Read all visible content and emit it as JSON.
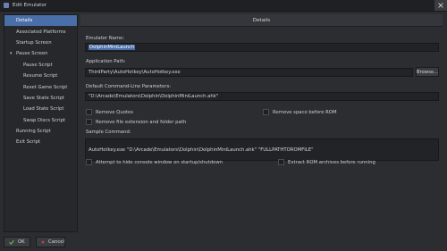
{
  "window": {
    "title": "Edit Emulator"
  },
  "sidebar": {
    "items": [
      {
        "label": "Details",
        "active": true,
        "sub": false
      },
      {
        "label": "Associated Platforms",
        "active": false,
        "sub": false
      },
      {
        "label": "Startup Screen",
        "active": false,
        "sub": false
      },
      {
        "label": "Pause Screen",
        "active": false,
        "sub": false,
        "expanded": true
      },
      {
        "label": "Pause Script",
        "active": false,
        "sub": true
      },
      {
        "label": "Resume Script",
        "active": false,
        "sub": true
      },
      {
        "label": "Reset Game Script",
        "active": false,
        "sub": true
      },
      {
        "label": "Save State Script",
        "active": false,
        "sub": true
      },
      {
        "label": "Load State Script",
        "active": false,
        "sub": true
      },
      {
        "label": "Swap Discs Script",
        "active": false,
        "sub": true
      },
      {
        "label": "Running Script",
        "active": false,
        "sub": false
      },
      {
        "label": "Exit Script",
        "active": false,
        "sub": false
      }
    ]
  },
  "details": {
    "header": "Details",
    "emulator_name_label": "Emulator Name:",
    "emulator_name_value": "DolphinMiniLaunch",
    "app_path_label": "Application Path:",
    "app_path_value": "ThirdParty\\AutoHotkey\\AutoHotkey.exe",
    "browse_label": "Browse...",
    "params_label": "Default Command-Line Parameters:",
    "params_value": "\"D:\\Arcade\\Emulators\\Dolphin\\DolphinMiniLaunch.ahk\"",
    "remove_quotes": "Remove Quotes",
    "remove_space": "Remove space before ROM",
    "remove_ext": "Remove file extension and folder path",
    "sample_label": "Sample Command:",
    "sample_value": "AutoHotkey.exe \"D:\\Arcade\\Emulators\\Dolphin\\DolphinMiniLaunch.ahk\" \"FULLPATHTOROMFILE\"",
    "hide_console": "Attempt to hide console window on startup/shutdown",
    "extract_rom": "Extract ROM archives before running"
  },
  "footer": {
    "ok_label": "OK",
    "cancel_label": "Cancel"
  },
  "colors": {
    "accent": "#4a6ea8",
    "ok_green": "#6cc04a",
    "cancel_red": "#d9534f"
  }
}
